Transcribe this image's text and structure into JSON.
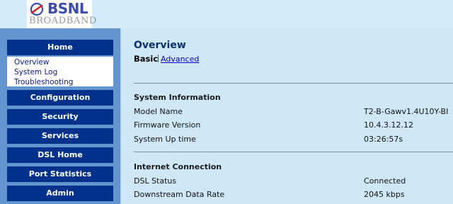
{
  "logo": {
    "brand": "BSNL",
    "sub": "BROADBAND"
  },
  "sidebar": {
    "home": "Home",
    "home_items": [
      "Overview",
      "System Log",
      "Troubleshooting"
    ],
    "items": [
      "Configuration",
      "Security",
      "Services",
      "DSL Home",
      "Port Statistics",
      "Admin"
    ]
  },
  "main": {
    "title": "Overview",
    "tab_basic": "Basic",
    "tab_advanced": "Advanced",
    "system_info": {
      "heading": "System Information",
      "rows": [
        {
          "label": "Model Name",
          "value": "T2-B-Gawv1.4U10Y-BI"
        },
        {
          "label": "Firmware Version",
          "value": "10.4.3.12.12"
        },
        {
          "label": "System Up time",
          "value": "03:26:57s"
        }
      ]
    },
    "internet": {
      "heading": "Internet Connection",
      "rows": [
        {
          "label": "DSL Status",
          "value": "Connected"
        },
        {
          "label": "Downstream Data Rate",
          "value": "2045 kbps"
        }
      ]
    }
  },
  "colors": {
    "nav_button": "#00318b",
    "sidebar_bg": "#6294cf",
    "page_bg": "#cfe8f8",
    "title": "#07306e",
    "logo_brand": "#3b4cad"
  }
}
